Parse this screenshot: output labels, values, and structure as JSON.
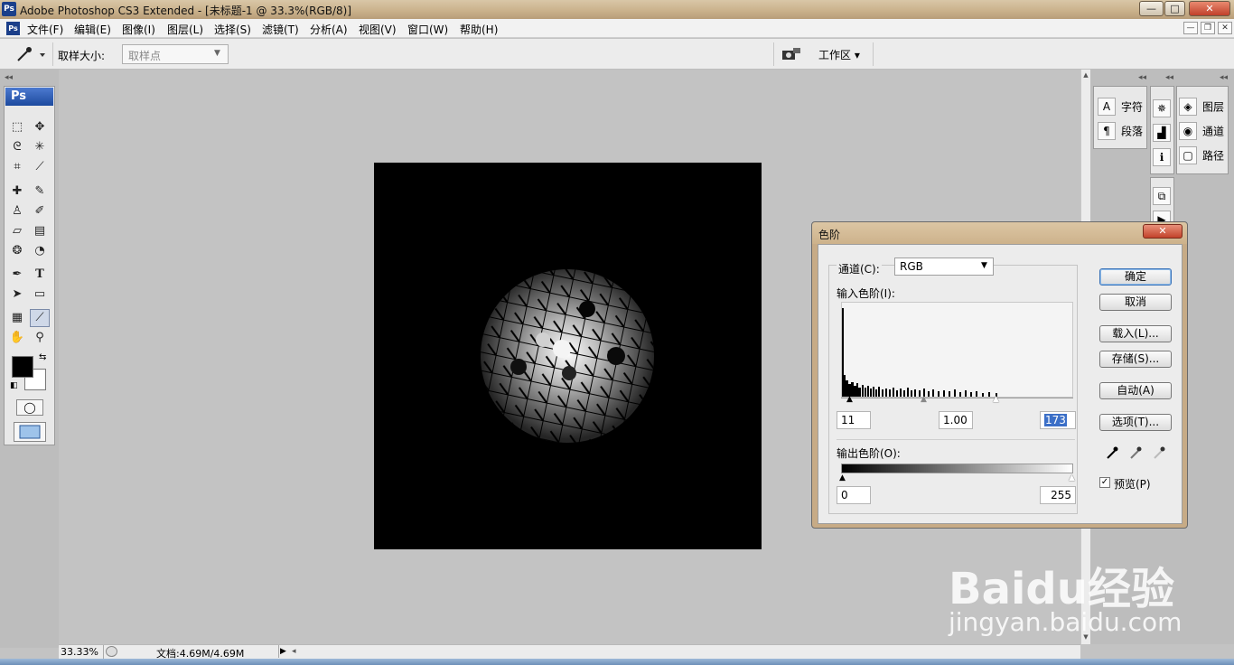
{
  "window": {
    "title": "Adobe Photoshop CS3 Extended - [未标题-1 @ 33.3%(RGB/8)]",
    "logo": "Ps",
    "min_btn": "—",
    "max_btn": "□",
    "close_btn": "✕"
  },
  "menubar": {
    "logo": "Ps",
    "items": [
      "文件(F)",
      "编辑(E)",
      "图像(I)",
      "图层(L)",
      "选择(S)",
      "滤镜(T)",
      "分析(A)",
      "视图(V)",
      "窗口(W)",
      "帮助(H)"
    ],
    "doc_min": "—",
    "doc_restore": "❐",
    "doc_close": "✕"
  },
  "options_bar": {
    "tool_icon": "eyedropper-icon",
    "sample_size_label": "取样大小:",
    "sample_size_value": "取样点",
    "workspace_label": "工作区 ▾"
  },
  "toolbox": {
    "header": "Ps"
  },
  "panels": {
    "col1": [
      {
        "icon": "character-icon",
        "glyph": "A",
        "label": "字符"
      },
      {
        "icon": "paragraph-icon",
        "glyph": "¶",
        "label": "段落"
      }
    ],
    "col3": [
      {
        "icon": "layers-icon",
        "glyph": "◈",
        "label": "图层"
      },
      {
        "icon": "channels-icon",
        "glyph": "◉",
        "label": "通道"
      },
      {
        "icon": "paths-icon",
        "glyph": "▢",
        "label": "路径"
      }
    ]
  },
  "status_bar": {
    "zoom": "33.33%",
    "doc_info": "文档:4.69M/4.69M"
  },
  "levels_dialog": {
    "title": "色阶",
    "close": "✕",
    "channel_label": "通道(C):",
    "channel_value": "RGB",
    "input_levels_label": "输入色阶(I):",
    "input_black": "11",
    "input_gamma": "1.00",
    "input_white": "173",
    "output_levels_label": "输出色阶(O):",
    "output_black": "0",
    "output_white": "255",
    "buttons": {
      "ok": "确定",
      "cancel": "取消",
      "load": "载入(L)...",
      "save": "存储(S)...",
      "auto": "自动(A)",
      "options": "选项(T)..."
    },
    "preview_label": "预览(P)",
    "preview_checked": true
  },
  "watermark": {
    "main": "Baidu经验",
    "sub": "jingyan.baidu.com"
  }
}
